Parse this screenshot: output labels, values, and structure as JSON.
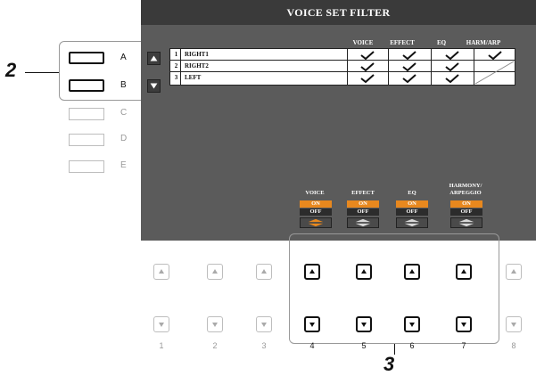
{
  "screen": {
    "title": "VOICE SET FILTER",
    "columns": [
      "VOICE",
      "EFFECT",
      "EQ",
      "HARM/ARP"
    ],
    "parts": [
      {
        "num": "1",
        "name": "RIGHT1",
        "checks": [
          true,
          true,
          true,
          true
        ]
      },
      {
        "num": "2",
        "name": "RIGHT2",
        "checks": [
          true,
          true,
          true,
          false
        ]
      },
      {
        "num": "3",
        "name": "LEFT",
        "checks": [
          true,
          true,
          true,
          false
        ]
      }
    ],
    "toggles": [
      {
        "label": "VOICE",
        "on": "ON",
        "off": "OFF"
      },
      {
        "label": "EFFECT",
        "on": "ON",
        "off": "OFF"
      },
      {
        "label": "EQ",
        "on": "ON",
        "off": "OFF"
      },
      {
        "label": "HARMONY/\nARPEGGIO",
        "on": "ON",
        "off": "OFF"
      }
    ]
  },
  "side_buttons": [
    {
      "label": "A",
      "active": true
    },
    {
      "label": "B",
      "active": true
    },
    {
      "label": "C",
      "active": false
    },
    {
      "label": "D",
      "active": false
    },
    {
      "label": "E",
      "active": false
    }
  ],
  "lower_buttons": [
    {
      "num": "1",
      "active": false
    },
    {
      "num": "2",
      "active": false
    },
    {
      "num": "3",
      "active": false
    },
    {
      "num": "4",
      "active": true
    },
    {
      "num": "5",
      "active": true
    },
    {
      "num": "6",
      "active": true
    },
    {
      "num": "7",
      "active": true
    },
    {
      "num": "8",
      "active": false
    }
  ],
  "callouts": {
    "left": "2",
    "bottom": "3"
  }
}
